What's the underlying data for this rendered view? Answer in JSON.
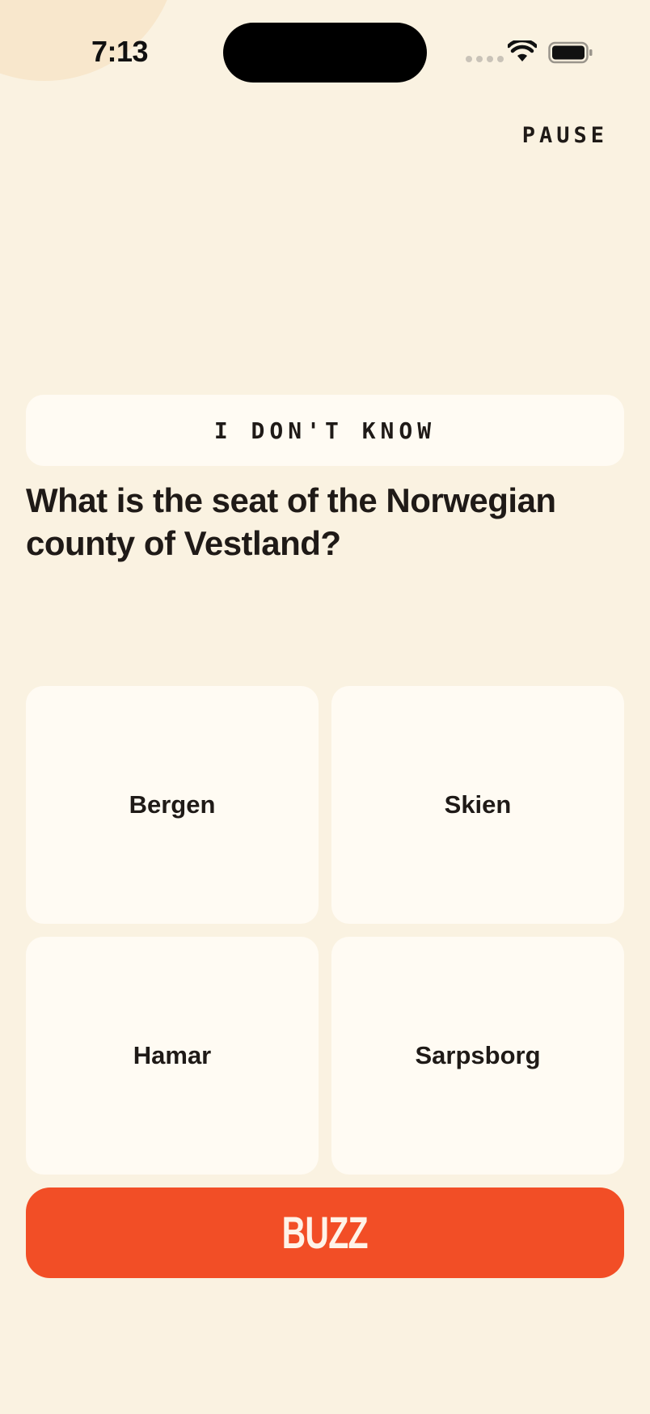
{
  "status_bar": {
    "time": "7:13"
  },
  "header": {
    "pause_label": "PAUSE"
  },
  "dont_know_label": "I DON'T KNOW",
  "question": "What is the seat of the Norwegian county of Vestland?",
  "answers": [
    {
      "label": "Bergen"
    },
    {
      "label": "Skien"
    },
    {
      "label": "Hamar"
    },
    {
      "label": "Sarpsborg"
    }
  ],
  "buzz_label": "BUZZ",
  "colors": {
    "background": "#FAF2E1",
    "card": "#FFFBF3",
    "accent": "#F24E26",
    "text": "#1F1A17"
  },
  "icons": [
    "wifi-icon",
    "battery-icon",
    "cellular-signal-icon"
  ]
}
